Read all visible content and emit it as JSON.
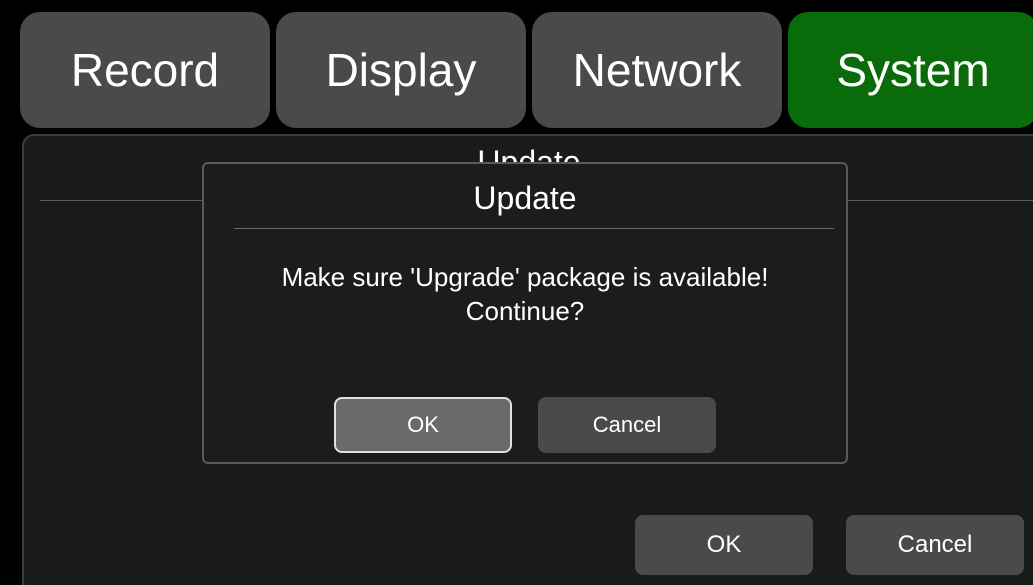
{
  "tabs": [
    {
      "label": "Record",
      "active": false
    },
    {
      "label": "Display",
      "active": false
    },
    {
      "label": "Network",
      "active": false
    },
    {
      "label": "System",
      "active": true
    }
  ],
  "panel": {
    "title": "Update",
    "ok_label": "OK",
    "cancel_label": "Cancel"
  },
  "dialog": {
    "title": "Update",
    "message_line1": "Make sure 'Upgrade' package is available!",
    "message_line2": "Continue?",
    "ok_label": "OK",
    "cancel_label": "Cancel"
  },
  "colors": {
    "active_tab": "#0a6b0a",
    "tab": "#4a4a4a",
    "background": "#000000"
  }
}
